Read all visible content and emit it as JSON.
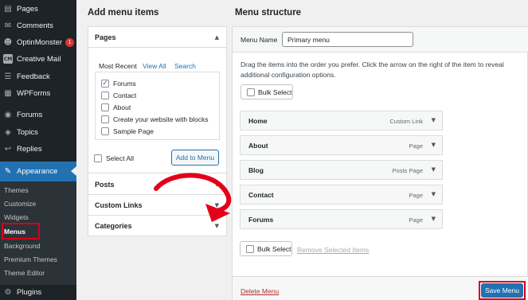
{
  "sidebar": {
    "items": [
      {
        "label": "Pages",
        "icon": "pages-icon"
      },
      {
        "label": "Comments",
        "icon": "comments-icon"
      },
      {
        "label": "OptinMonster",
        "icon": "optinmonster-icon",
        "badge": "1"
      },
      {
        "label": "Creative Mail",
        "icon": "creative-mail-icon",
        "icon_text": "CM"
      },
      {
        "label": "Feedback",
        "icon": "feedback-icon"
      },
      {
        "label": "WPForms",
        "icon": "wpforms-icon"
      },
      {
        "label": "Forums",
        "icon": "forums-icon"
      },
      {
        "label": "Topics",
        "icon": "topics-icon"
      },
      {
        "label": "Replies",
        "icon": "replies-icon"
      },
      {
        "label": "Appearance",
        "icon": "appearance-icon"
      },
      {
        "label": "Plugins",
        "icon": "plugins-icon"
      }
    ],
    "submenu": [
      "Themes",
      "Customize",
      "Widgets",
      "Menus",
      "Background",
      "Premium Themes",
      "Theme Editor"
    ]
  },
  "add_items": {
    "heading": "Add menu items",
    "pages": {
      "title": "Pages",
      "tabs": [
        "Most Recent",
        "View All",
        "Search"
      ],
      "options": [
        {
          "label": "Forums",
          "checked": true
        },
        {
          "label": "Contact",
          "checked": false
        },
        {
          "label": "About",
          "checked": false
        },
        {
          "label": "Create your website with blocks",
          "checked": false
        },
        {
          "label": "Sample Page",
          "checked": false
        }
      ],
      "select_all": "Select All",
      "add_button": "Add to Menu"
    },
    "sections": [
      "Posts",
      "Custom Links",
      "Categories"
    ]
  },
  "structure": {
    "heading": "Menu structure",
    "menu_name_label": "Menu Name",
    "menu_name_value": "Primary menu",
    "instructions": "Drag the items into the order you prefer. Click the arrow on the right of the item to reveal additional configuration options.",
    "bulk_select": "Bulk Select",
    "items": [
      {
        "title": "Home",
        "type": "Custom Link"
      },
      {
        "title": "About",
        "type": "Page"
      },
      {
        "title": "Blog",
        "type": "Posts Page"
      },
      {
        "title": "Contact",
        "type": "Page"
      },
      {
        "title": "Forums",
        "type": "Page"
      }
    ],
    "remove_selected": "Remove Selected Items",
    "delete_menu": "Delete Menu",
    "save_menu": "Save Menu"
  },
  "colors": {
    "accent": "#2271b1",
    "highlight": "#d6001c",
    "sidebar": "#1d2327"
  }
}
